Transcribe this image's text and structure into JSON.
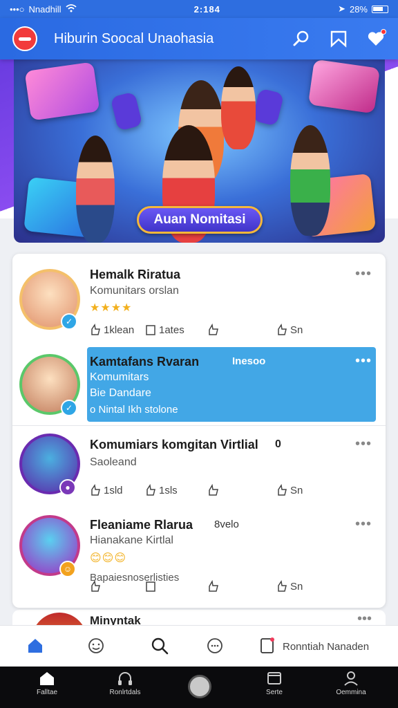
{
  "status_bar": {
    "carrier": "Nnadhill",
    "time": "2:184",
    "battery": "28%"
  },
  "header": {
    "title": "Hiburin Soocal Unaohasia"
  },
  "banner": {
    "button_label": "Auan Nomitasi"
  },
  "feed": [
    {
      "title": "Hemalk Riratua",
      "subtitle": "Komunitars orslan",
      "stars": "★★★★",
      "actions": [
        "1klean",
        "1ates",
        "",
        "Sn"
      ]
    },
    {
      "title": "Kamtafans Rvaran",
      "title_extra": "Inesoo",
      "subtitle": "Komumitars",
      "subtitle2": "Bie Dandare",
      "footer": "o Nintal Ikh stolone"
    },
    {
      "title": "Komumiars komgitan Virtlial",
      "title_extra": "0",
      "subtitle": "Saoleand",
      "actions": [
        "1sld",
        "1sls",
        "",
        "Sn"
      ]
    },
    {
      "title": "Fleaniame Rlarua",
      "title_extra": "8velo",
      "subtitle": "Hianakane Kirtlal",
      "caption": "Bapaiesnoserlisties",
      "actions": [
        "Sn"
      ]
    },
    {
      "title": "Minyntak"
    }
  ],
  "tab_strip": {
    "right_label": "Ronntiah Nanaden"
  },
  "bottom_nav": {
    "items": [
      "Falltae",
      "Ronlrtdals",
      "",
      "Serte",
      "Oemmina"
    ]
  },
  "colors": {
    "primary": "#2e6ee0",
    "highlight": "#42a7e6",
    "logo_red": "#f23b3b"
  }
}
